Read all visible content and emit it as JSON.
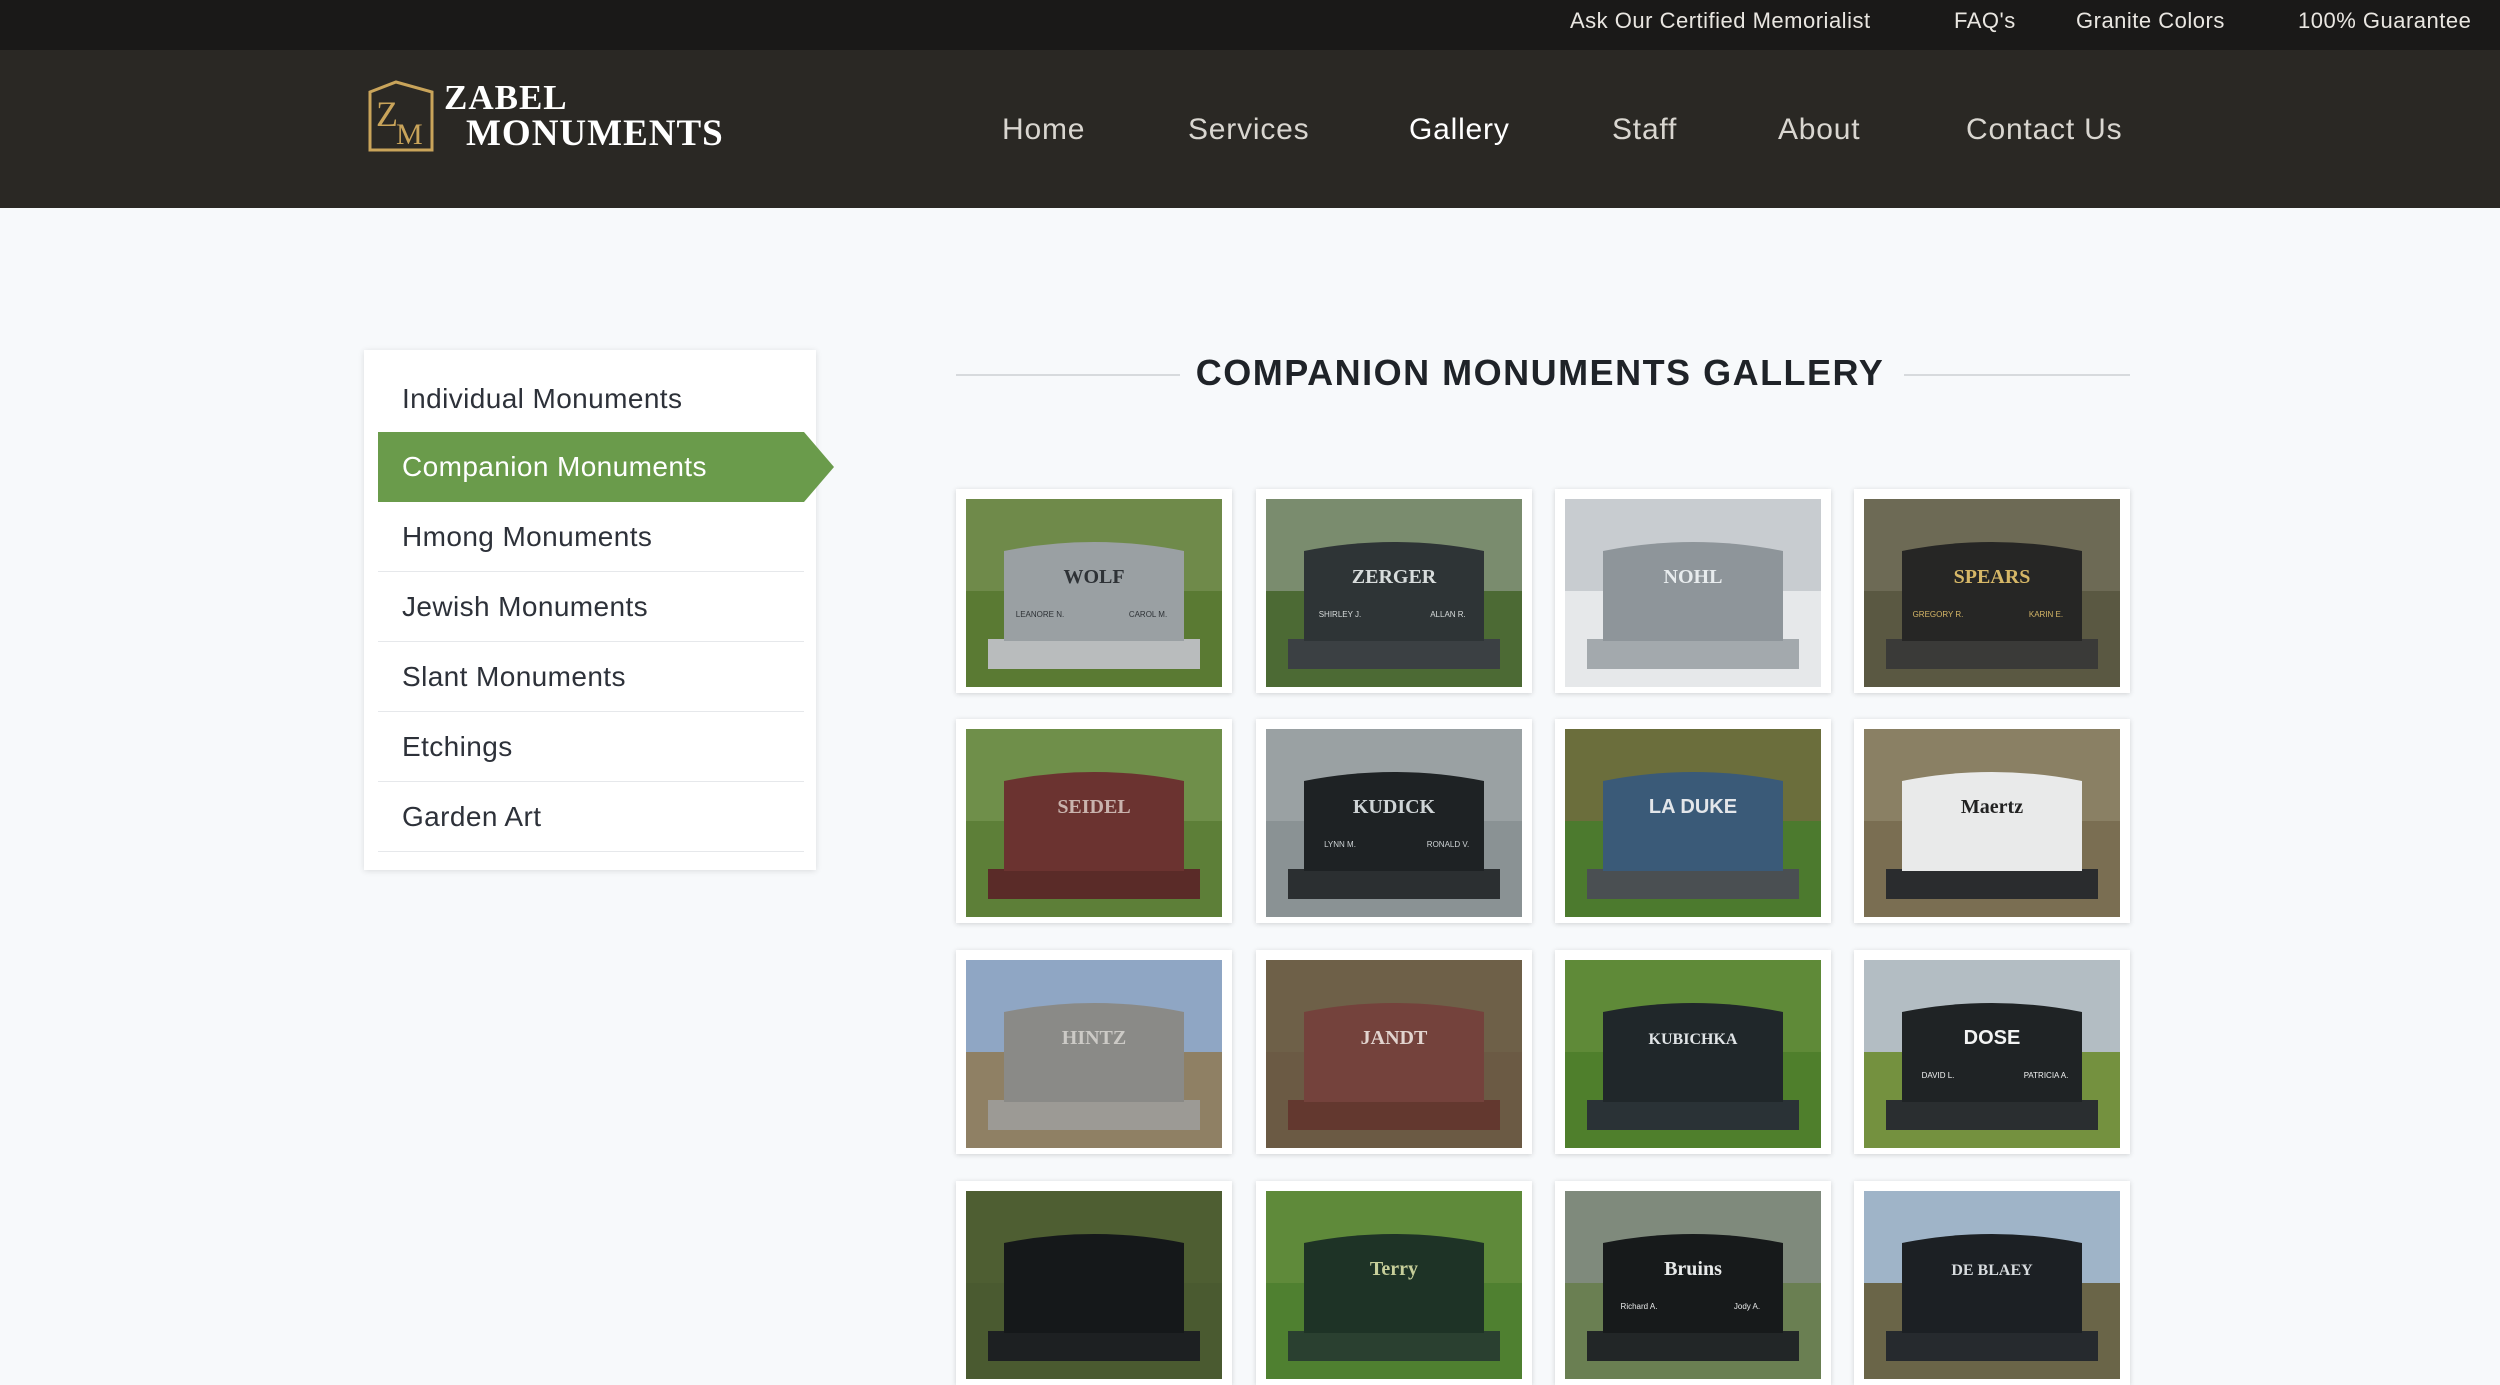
{
  "topbar": {
    "links": [
      "Ask Our Certified Memorialist",
      "FAQ's",
      "Granite Colors",
      "100% Guarantee"
    ]
  },
  "brand": {
    "line1": "ZABEL",
    "line2": "MONUMENTS",
    "mark": "ZM"
  },
  "nav": {
    "items": [
      "Home",
      "Services",
      "Gallery",
      "Staff",
      "About",
      "Contact Us"
    ],
    "active": "Gallery"
  },
  "sidebar": {
    "items": [
      "Individual Monuments",
      "Companion Monuments",
      "Hmong Monuments",
      "Jewish Monuments",
      "Slant Monuments",
      "Etchings",
      "Garden Art"
    ],
    "active": "Companion Monuments"
  },
  "gallery": {
    "title": "COMPANION MONUMENTS GALLERY",
    "thumbnails": [
      {
        "name": "WOLF",
        "sub_left": "LEANORE N.",
        "sub_right": "CAROL M."
      },
      {
        "name": "ZERGER",
        "sub_left": "SHIRLEY J.",
        "sub_right": "ALLAN R."
      },
      {
        "name": "NOHL",
        "sub_left": "",
        "sub_right": ""
      },
      {
        "name": "SPEARS",
        "sub_left": "GREGORY R.",
        "sub_right": "KARIN E."
      },
      {
        "name": "SEIDEL",
        "sub_left": "",
        "sub_right": ""
      },
      {
        "name": "KUDICK",
        "sub_left": "LYNN M.",
        "sub_right": "RONALD V."
      },
      {
        "name": "LA DUKE",
        "sub_left": "",
        "sub_right": ""
      },
      {
        "name": "Maertz",
        "sub_left": "",
        "sub_right": ""
      },
      {
        "name": "HINTZ",
        "sub_left": "",
        "sub_right": ""
      },
      {
        "name": "JANDT",
        "sub_left": "",
        "sub_right": ""
      },
      {
        "name": "KUBICHKA",
        "sub_left": "",
        "sub_right": ""
      },
      {
        "name": "DOSE",
        "sub_left": "DAVID L.",
        "sub_right": "PATRICIA A."
      },
      {
        "name": "",
        "sub_left": "",
        "sub_right": ""
      },
      {
        "name": "Terry",
        "sub_left": "",
        "sub_right": ""
      },
      {
        "name": "Bruins",
        "sub_left": "Richard A.",
        "sub_right": "Jody A."
      },
      {
        "name": "DE BLAEY",
        "sub_left": "",
        "sub_right": ""
      }
    ]
  },
  "colors": {
    "topbar_bg": "#1a1918",
    "header_bg": "#2a2824",
    "accent_green": "#6a9b4b",
    "logo_gold": "#c9a45a",
    "page_bg": "#f7f9fb"
  }
}
